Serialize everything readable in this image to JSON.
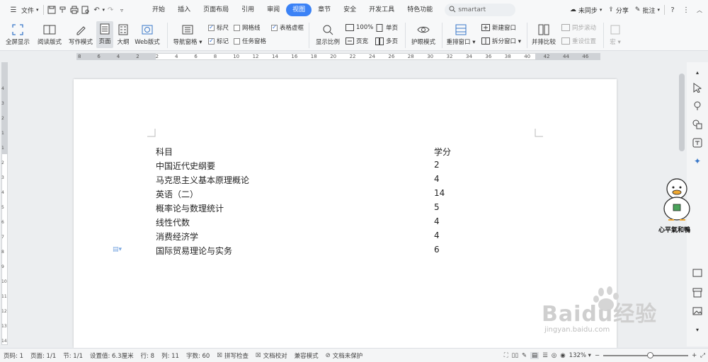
{
  "menubar": {
    "file_label": "文件",
    "tabs": [
      "开始",
      "插入",
      "页面布局",
      "引用",
      "审阅",
      "视图",
      "章节",
      "安全",
      "开发工具",
      "特色功能"
    ],
    "active_tab": "视图",
    "search_value": "smartart",
    "sync_label": "未同步",
    "share_label": "分享",
    "comment_label": "批注"
  },
  "ribbon": {
    "fullscreen": "全屏显示",
    "reading_mode": "阅读版式",
    "writing_mode": "写作模式",
    "page_view": "页面",
    "outline": "大纲",
    "web_view": "Web版式",
    "nav_pane": "导航窗格",
    "ruler": "标尺",
    "gridlines": "网格线",
    "table_gridlines": "表格虚框",
    "marks": "标记",
    "task_pane": "任务窗格",
    "zoom_ratio": "显示比例",
    "zoom_100": "100%",
    "single_page": "单页",
    "page_width": "页宽",
    "multi_page": "多页",
    "eye_mode": "护眼模式",
    "rearrange_window": "重排窗口",
    "new_window": "新建窗口",
    "split_window": "拆分窗口",
    "side_by_side": "并排比较",
    "sync_scroll": "同步滚动",
    "reset_position": "重设位置",
    "macro": "宏"
  },
  "hruler_ticks": [
    "8",
    "6",
    "4",
    "2",
    "2",
    "4",
    "6",
    "8",
    "10",
    "12",
    "14",
    "16",
    "18",
    "20",
    "22",
    "24",
    "26",
    "28",
    "30",
    "32",
    "34",
    "36",
    "38",
    "40",
    "42",
    "44",
    "46"
  ],
  "vruler_ticks": [
    "4",
    "3",
    "2",
    "1",
    "1",
    "2",
    "3",
    "4",
    "5",
    "6",
    "7",
    "8",
    "9",
    "10",
    "11",
    "12",
    "13",
    "14"
  ],
  "document": {
    "header": {
      "subject": "科目",
      "credits": "学分"
    },
    "rows": [
      {
        "subject": "中国近代史纲要",
        "credits": "2"
      },
      {
        "subject": "马克思主义基本原理概论",
        "credits": "4"
      },
      {
        "subject": "英语（二）",
        "credits": "14"
      },
      {
        "subject": "概率论与数理统计",
        "credits": "5"
      },
      {
        "subject": "线性代数",
        "credits": "4"
      },
      {
        "subject": "消费经济学",
        "credits": "4"
      },
      {
        "subject": "国际贸易理论与实务",
        "credits": "6"
      }
    ]
  },
  "statusbar": {
    "page_no": "页码: 1",
    "pages": "页面: 1/1",
    "section": "节: 1/1",
    "setting": "设置值: 6.3厘米",
    "row": "行: 8",
    "col": "列: 11",
    "word_count": "字数: 60",
    "spell_check": "拼写检查",
    "doc_check": "文档校对",
    "compat_mode": "兼容模式",
    "protect": "文档未保护",
    "zoom": "132%",
    "zoom_level": 0.55
  },
  "watermark": {
    "baidu_main": "Baidu经验",
    "baidu_sub": "jingyan.baidu.com",
    "duck_text": "心平氣和鴨"
  },
  "colors": {
    "accent": "#3b82f6",
    "page": "#ffffff",
    "chrome": "#f7f8f9"
  }
}
